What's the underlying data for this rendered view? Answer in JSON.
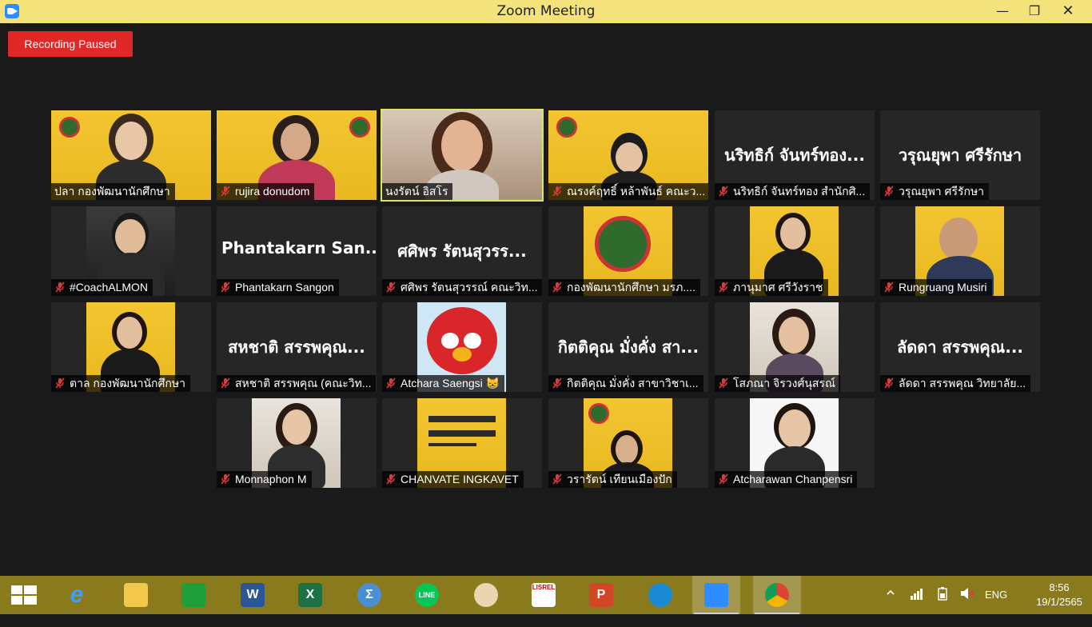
{
  "window": {
    "title": "Zoom Meeting",
    "minimize": "—",
    "maximize": "❐",
    "close": "✕"
  },
  "recording_status": "Recording Paused",
  "participants": [
    {
      "name": "ปลา กองพัฒนานักศึกษา",
      "muted": false,
      "video": true
    },
    {
      "name": "rujira donudom",
      "muted": true,
      "video": true
    },
    {
      "name": "นงรัตน์ อิสโร",
      "muted": false,
      "video": true,
      "active_speaker": true
    },
    {
      "name": "ณรงค์ฤทธิ์ หล้าพันธ์ คณะว...",
      "muted": true,
      "video": true
    },
    {
      "name": "นริทธิก์ จันทร์ทอง สำนักศิ...",
      "display_name": "นริทธิก์ จันทร์ทอง...",
      "muted": true,
      "video": false
    },
    {
      "name": "วรุณยุพา ศรีรักษา",
      "display_name": "วรุณยุพา ศรีรักษา",
      "muted": true,
      "video": false
    },
    {
      "name": "#CoachALMON",
      "muted": true,
      "video": true
    },
    {
      "name": "Phantakarn Sangon",
      "display_name": "Phantakarn San...",
      "muted": true,
      "video": false
    },
    {
      "name": "ศศิพร รัตนสุวรรณ์ คณะวิท...",
      "display_name": "ศศิพร รัตนสุวรร...",
      "muted": true,
      "video": false
    },
    {
      "name": "กองพัฒนานักศึกษา มรภ....",
      "muted": true,
      "video": true
    },
    {
      "name": "ภานุมาศ ศรีวังราช",
      "muted": true,
      "video": true
    },
    {
      "name": "Rungruang Musiri",
      "muted": true,
      "video": true
    },
    {
      "name": "ตาล กองพัฒนานักศึกษา",
      "muted": true,
      "video": true
    },
    {
      "name": "สหชาติ สรรพคุณ (คณะวิท...",
      "display_name": "สหชาติ สรรพคุณ...",
      "muted": true,
      "video": false
    },
    {
      "name": "Atchara Saengsi 😸",
      "muted": true,
      "video": true
    },
    {
      "name": "กิตติคุณ มั่งคั่ง สาขาวิชาเ...",
      "display_name": "กิตติคุณ มั่งคั่ง สา...",
      "muted": true,
      "video": false
    },
    {
      "name": "โสภณา จิรวงศ์นุสรณ์",
      "muted": true,
      "video": true
    },
    {
      "name": "ลัดดา สรรพคุณ วิทยาลัย...",
      "display_name": "ลัดดา สรรพคุณ...",
      "muted": true,
      "video": false
    },
    {
      "name": "Monnaphon M",
      "muted": true,
      "video": true
    },
    {
      "name": "CHANVATE INGKAVET",
      "muted": true,
      "video": true
    },
    {
      "name": "วรารัตน์ เทียนเมืองปัก",
      "muted": true,
      "video": true
    },
    {
      "name": "Atcharawan Chanpensri",
      "muted": true,
      "video": true
    }
  ],
  "taskbar": {
    "apps": [
      {
        "icon": "internet-explorer-icon",
        "label": "e"
      },
      {
        "icon": "file-explorer-icon",
        "label": ""
      },
      {
        "icon": "store-icon",
        "label": ""
      },
      {
        "icon": "word-icon",
        "label": "W"
      },
      {
        "icon": "excel-icon",
        "label": "X"
      },
      {
        "icon": "math-input-icon",
        "label": "Σ"
      },
      {
        "icon": "line-icon",
        "label": "LINE"
      },
      {
        "icon": "paint-icon",
        "label": ""
      },
      {
        "icon": "lisrel-icon",
        "label": "LISREL"
      },
      {
        "icon": "powerpoint-icon",
        "label": "P"
      },
      {
        "icon": "edge-icon",
        "label": ""
      },
      {
        "icon": "zoom-icon",
        "label": ""
      },
      {
        "icon": "chrome-icon",
        "label": ""
      }
    ],
    "language": "ENG",
    "time": "8:56",
    "date": "19/1/2565"
  },
  "colors": {
    "titlebar": "#f4e27a",
    "recording_badge": "#e02828",
    "active_speaker_border": "#d8e55f",
    "taskbar": "#8a7a1e",
    "muted_mic": "#e03a3a"
  }
}
